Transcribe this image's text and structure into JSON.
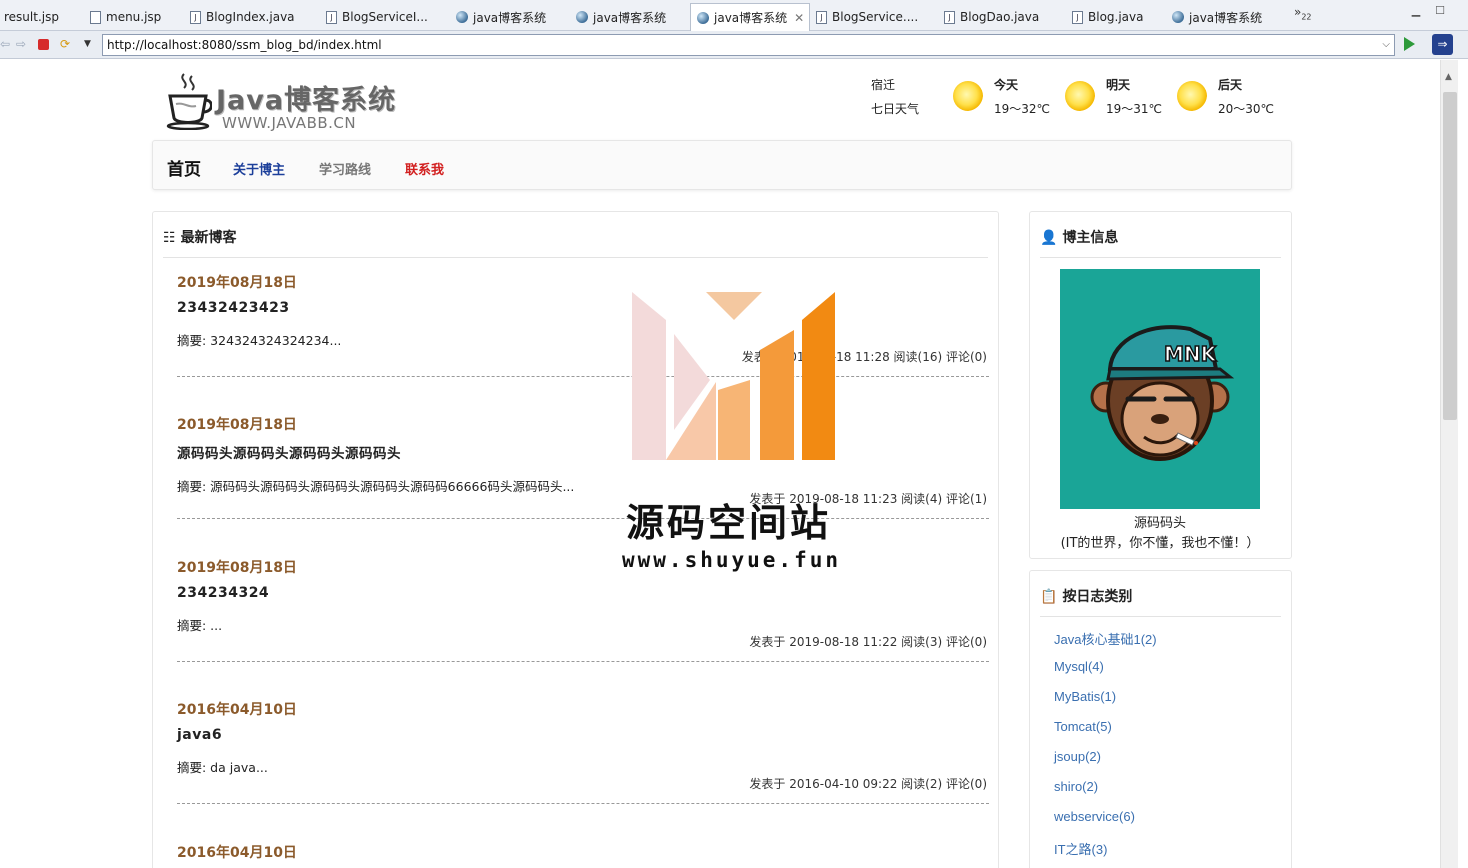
{
  "ide": {
    "tabs": [
      {
        "label": "result.jsp",
        "icon": "file-icon"
      },
      {
        "label": "menu.jsp",
        "icon": "file-icon"
      },
      {
        "label": "BlogIndex.java",
        "icon": "java-file-icon"
      },
      {
        "label": "BlogServiceI...",
        "icon": "java-file-icon"
      },
      {
        "label": "java博客系统",
        "icon": "globe-icon"
      },
      {
        "label": "java博客系统",
        "icon": "globe-icon"
      },
      {
        "label": "java博客系统",
        "icon": "globe-icon",
        "active": true
      },
      {
        "label": "BlogService....",
        "icon": "java-file-icon"
      },
      {
        "label": "BlogDao.java",
        "icon": "java-file-icon"
      },
      {
        "label": "Blog.java",
        "icon": "java-file-icon"
      },
      {
        "label": "java博客系统",
        "icon": "globe-icon"
      }
    ],
    "overflow_label": "»",
    "overflow_count": "22"
  },
  "browser": {
    "url": "http://localhost:8080/ssm_blog_bd/index.html"
  },
  "site": {
    "logo_title": "Java博客系统",
    "logo_sub": "WWW.JAVABB.CN",
    "weather": {
      "city": "宿迁",
      "subtitle": "七日天气",
      "days": [
        {
          "day": "今天",
          "temp": "19～32℃",
          "icon": "sun-icon"
        },
        {
          "day": "明天",
          "temp": "19～31℃",
          "icon": "sun-icon"
        },
        {
          "day": "后天",
          "temp": "20～30℃",
          "icon": "sun-icon"
        }
      ]
    },
    "nav": {
      "home": "首页",
      "about": "关于博主",
      "route": "学习路线",
      "contact": "联系我"
    },
    "colors": {
      "nav_about": "#1c3f9a",
      "nav_route": "#777777",
      "nav_contact": "#d22020",
      "date": "#8b5a2b",
      "category_link": "#3a6fb0",
      "avatar_bg": "#1aa597"
    }
  },
  "blogs": {
    "heading": "最新博客",
    "items": [
      {
        "date": "2019年08月18日",
        "title": "23432423423",
        "summary": "摘要: 324324324324234...",
        "meta": "发表于 2019-08-18 11:28 阅读(16) 评论(0)"
      },
      {
        "date": "2019年08月18日",
        "title": "源码码头源码码头源码码头源码码头",
        "summary": "摘要: 源码码头源码码头源码码头源码码头源码码66666码头源码码头...",
        "meta": "发表于 2019-08-18 11:23 阅读(4) 评论(1)"
      },
      {
        "date": "2019年08月18日",
        "title": "234234324",
        "summary": "摘要: ...",
        "meta": "发表于 2019-08-18 11:22 阅读(3) 评论(0)"
      },
      {
        "date": "2016年04月10日",
        "title": "java6",
        "summary": "摘要: da java...",
        "meta": "发表于 2016-04-10 09:22 阅读(2) 评论(0)"
      },
      {
        "date": "2016年04月10日",
        "title": "",
        "summary": "",
        "meta": ""
      }
    ]
  },
  "owner": {
    "heading": "博主信息",
    "avatar_text": "MNK",
    "name": "源码码头",
    "motto": "(IT的世界，你不懂，我也不懂！）"
  },
  "categories": {
    "heading": "按日志类别",
    "items": [
      "Java核心基础1(2)",
      "Mysql(4)",
      "MyBatis(1)",
      "Tomcat(5)",
      "jsoup(2)",
      "shiro(2)",
      "webservice(6)",
      "IT之路(3)"
    ]
  },
  "watermark": {
    "line1": "源码空间站",
    "line2": "www.shuyue.fun"
  }
}
